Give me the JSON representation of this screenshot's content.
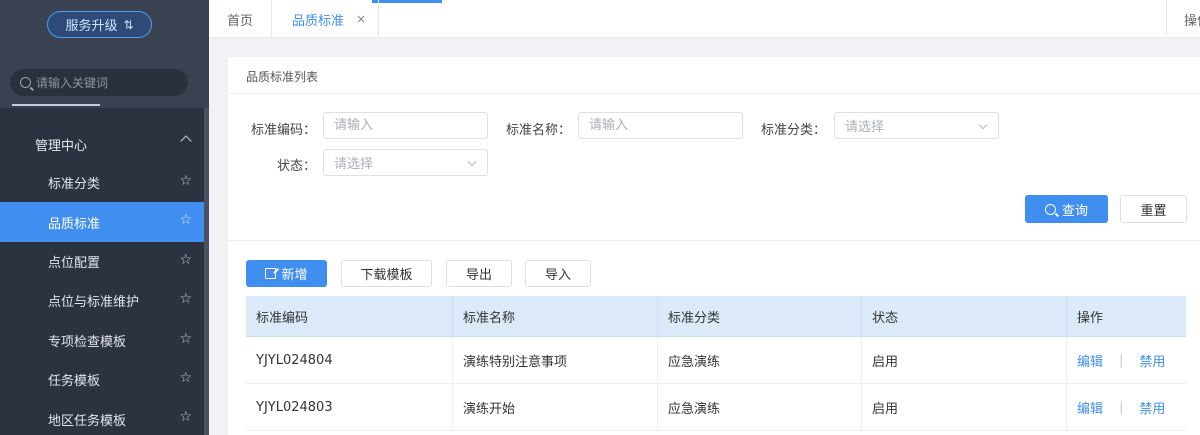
{
  "sidebar": {
    "upgrade_label": "服务升级",
    "search_placeholder": "请输入关键词",
    "group_label": "管理中心",
    "items": [
      {
        "label": "标准分类"
      },
      {
        "label": "品质标准"
      },
      {
        "label": "点位配置"
      },
      {
        "label": "点位与标准维护"
      },
      {
        "label": "专项检查模板"
      },
      {
        "label": "任务模板"
      },
      {
        "label": "地区任务模板"
      }
    ],
    "active_index": 1
  },
  "tabs": {
    "home": "首页",
    "current": "品质标准",
    "close_glyph": "×",
    "ops": "操作"
  },
  "panel": {
    "title": "品质标准列表"
  },
  "filters": {
    "code_label": "标准编码：",
    "code_placeholder": "请输入",
    "name_label": "标准名称：",
    "name_placeholder": "请输入",
    "category_label": "标准分类：",
    "category_placeholder": "请选择",
    "status_label": "状态：",
    "status_placeholder": "请选择",
    "query_label": "查询",
    "reset_label": "重置"
  },
  "toolbar": {
    "add_label": "新增",
    "download_label": "下载模板",
    "export_label": "导出",
    "import_label": "导入"
  },
  "table": {
    "headers": [
      "标准编码",
      "标准名称",
      "标准分类",
      "状态",
      "操作"
    ],
    "rows": [
      {
        "code": "YJYL024804",
        "name": "演练特别注意事项",
        "category": "应急演练",
        "status": "启用",
        "edit": "编辑",
        "sep": "|",
        "disable": "禁用"
      },
      {
        "code": "YJYL024803",
        "name": "演练开始",
        "category": "应急演练",
        "status": "启用",
        "edit": "编辑",
        "sep": "|",
        "disable": "禁用"
      }
    ]
  },
  "colors": {
    "primary": "#3f8ef0",
    "sidebar_bg": "#2b3240",
    "header_row": "#dbe9f8"
  }
}
